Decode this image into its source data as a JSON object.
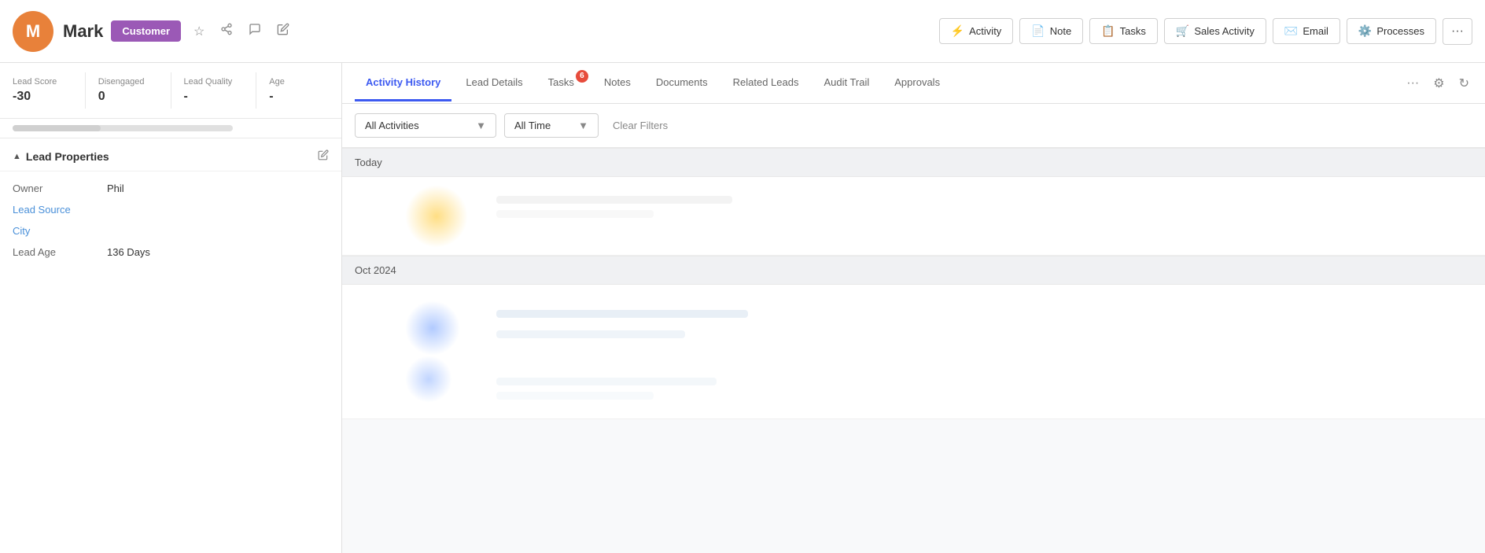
{
  "header": {
    "avatar_letter": "M",
    "name": "Mark",
    "badge": "Customer",
    "icons": [
      "star",
      "share",
      "chat",
      "edit"
    ]
  },
  "actions": {
    "activity_label": "Activity",
    "note_label": "Note",
    "tasks_label": "Tasks",
    "sales_activity_label": "Sales Activity",
    "email_label": "Email",
    "processes_label": "Processes",
    "more_label": "..."
  },
  "stats": [
    {
      "label": "Lead Score",
      "value": "-30"
    },
    {
      "label": "Disengaged",
      "value": "0"
    },
    {
      "label": "Lead Quality",
      "value": "-"
    },
    {
      "label": "Age",
      "value": "-"
    }
  ],
  "lead_properties": {
    "section_title": "Lead Properties",
    "rows": [
      {
        "label": "Owner",
        "label_type": "plain",
        "value": "Phil"
      },
      {
        "label": "Lead Source",
        "label_type": "link",
        "value": ""
      },
      {
        "label": "City",
        "label_type": "link",
        "value": ""
      },
      {
        "label": "Lead Age",
        "label_type": "plain",
        "value": "136 Days"
      }
    ]
  },
  "tabs": [
    {
      "id": "activity-history",
      "label": "Activity History",
      "badge": null,
      "active": true
    },
    {
      "id": "lead-details",
      "label": "Lead Details",
      "badge": null,
      "active": false
    },
    {
      "id": "tasks",
      "label": "Tasks",
      "badge": "6",
      "active": false
    },
    {
      "id": "notes",
      "label": "Notes",
      "badge": null,
      "active": false
    },
    {
      "id": "documents",
      "label": "Documents",
      "badge": null,
      "active": false
    },
    {
      "id": "related-leads",
      "label": "Related Leads",
      "badge": null,
      "active": false
    },
    {
      "id": "audit-trail",
      "label": "Audit Trail",
      "badge": null,
      "active": false
    },
    {
      "id": "approvals",
      "label": "Approvals",
      "badge": null,
      "active": false
    }
  ],
  "filters": {
    "activities_label": "All Activities",
    "activities_placeholder": "All Activities",
    "time_label": "All Time",
    "clear_filters": "Clear Filters"
  },
  "activity_sections": [
    {
      "id": "today",
      "header": "Today",
      "items": [
        {
          "type": "glow-yellow"
        }
      ]
    },
    {
      "id": "oct2024",
      "header": "Oct 2024",
      "items": [
        {
          "type": "glow-blue"
        }
      ]
    }
  ]
}
